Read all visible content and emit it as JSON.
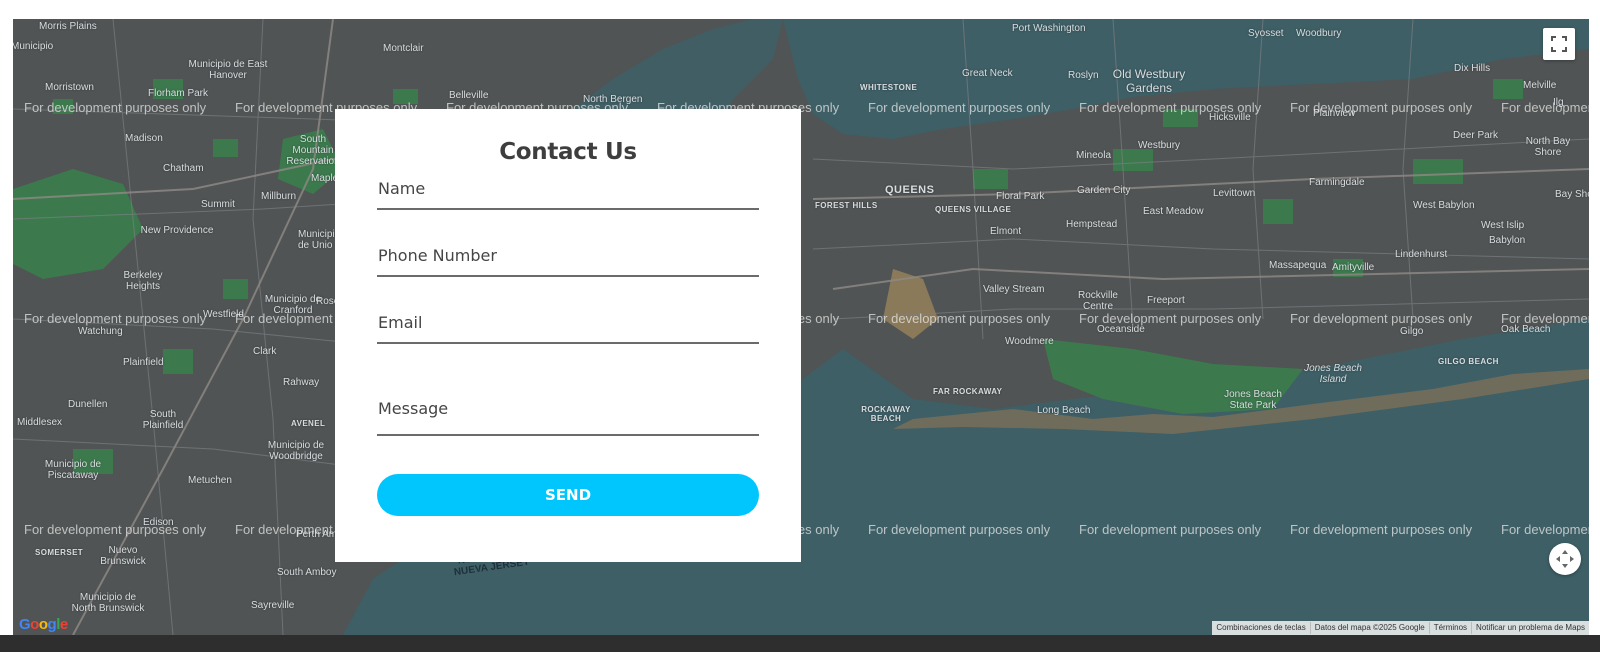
{
  "map": {
    "watermark": "For development purposes only",
    "colors": {
      "water": "#3e5f66",
      "land": "#505454",
      "park": "#3c7a4e",
      "road": "#7c7f82",
      "highway": "#8f8a86",
      "sand": "#8a7a5a"
    },
    "places": [
      "Morris Plains",
      "Montclair",
      "Port Washington",
      "Syosset",
      "Woodbury",
      "Municipio de East Hanover",
      "Morristown",
      "Florham Park",
      "Belleville",
      "North Bergen",
      "WHITESTONE",
      "Great Neck",
      "Roslyn",
      "Old Westbury Gardens",
      "Dix Hills",
      "Melville",
      "Madison",
      "South Mountain Reservation",
      "Hicksville",
      "Plainview",
      "Deer Park",
      "North Bay Shore",
      "Chatham",
      "QUEENS",
      "Mineola",
      "Westbury",
      "Summit",
      "Millburn",
      "FOREST HILLS",
      "QUEENS VILLAGE",
      "Floral Park",
      "Garden City",
      "Levittown",
      "Farmingdale",
      "New Providence",
      "Elmont",
      "Hempstead",
      "East Meadow",
      "West Babylon",
      "West Islip",
      "Babylon",
      "Berkeley Heights",
      "Massapequa",
      "Amityville",
      "Lindenhurst",
      "Valley Stream",
      "Rockville Centre",
      "Freeport",
      "Watchung",
      "Municipio de Cranford",
      "Clark",
      "Oceanside",
      "Gilgo",
      "Oak Beach",
      "Plainfield",
      "Woodmere",
      "GILGO BEACH",
      "Rahway",
      "FAR ROCKAWAY",
      "Jones Beach Island",
      "Dunellen",
      "ROCKAWAY BEACH",
      "Long Beach",
      "Jones Beach State Park",
      "Middlesex",
      "South Plainfield",
      "AVENEL",
      "Municipio de Woodbridge",
      "Municipio de Piscataway",
      "Metuchen",
      "Edison",
      "SOMERSET",
      "Nuevo Brunswick",
      "South Amboy",
      "Sayreville",
      "Municipio de North Brunswick",
      "NUEVA YORK NUEVA JERSEY",
      "Perth Am",
      "Municipio de Unio",
      "Westfield",
      "Rose",
      "Maple",
      "Bay Sho",
      "Ilg",
      "Municipio"
    ],
    "controls": {
      "fullscreen_icon": "fullscreen-icon",
      "pan_icon": "camera-control-icon"
    },
    "logo": "Google",
    "attribution": [
      "Combinaciones de teclas",
      "Datos del mapa ©2025 Google",
      "Términos",
      "Notificar un problema de Maps"
    ]
  },
  "form": {
    "title": "Contact Us",
    "fields": {
      "name_placeholder": "Name",
      "phone_placeholder": "Phone Number",
      "email_placeholder": "Email",
      "message_placeholder": "Message"
    },
    "send_label": "SEND",
    "accent": "#00c6fd"
  }
}
